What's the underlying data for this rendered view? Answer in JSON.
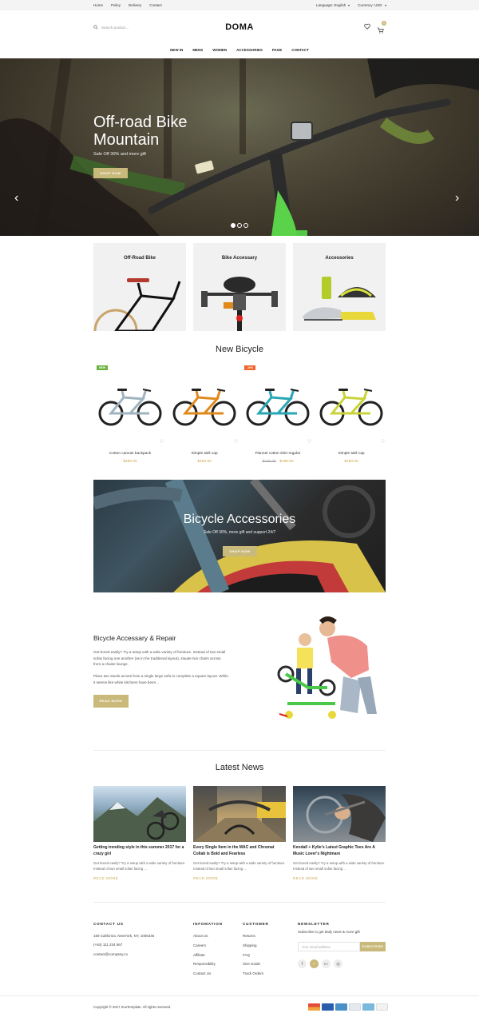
{
  "topbar": {
    "links": [
      "Home",
      "Policy",
      "Delivery",
      "Contact"
    ],
    "language": "Language: English",
    "currency": "Currency: USD"
  },
  "header": {
    "search_placeholder": "Search product...",
    "logo": "DOMA",
    "cart_count": "0"
  },
  "nav": [
    "NEW IN",
    "MENS",
    "WOMEN",
    "ACCESSORIES",
    "PAGE",
    "CONTACT"
  ],
  "hero": {
    "title_line1": "Off-road Bike",
    "title_line2": "Mountain",
    "subtitle": "Sale Off 30% and more gift",
    "cta": "SHOP NOW"
  },
  "categories": [
    "Off-Road Bike",
    "Bike Accessary",
    "Accessories"
  ],
  "new_bicycle": {
    "heading": "New Bicycle",
    "products": [
      {
        "name": "Cotton canvas backpack",
        "price": "$180.00",
        "old_price": "",
        "badge": "NEW",
        "frame_color": "#9fb4bf"
      },
      {
        "name": "Simple twill cap",
        "price": "$180.00",
        "old_price": "",
        "badge": "",
        "frame_color": "#e08a1e"
      },
      {
        "name": "Flannel cotton shirt regular",
        "price": "$199.00",
        "old_price": "$230.00",
        "badge": "-10%",
        "frame_color": "#2aa6b4"
      },
      {
        "name": "Simple twill cap",
        "price": "$180.00",
        "old_price": "",
        "badge": "",
        "frame_color": "#c8d43a"
      }
    ]
  },
  "accessories_banner": {
    "title": "Bicycle Accessories",
    "subtitle": "Sale Off 30%, more gift and support 24/7",
    "cta": "SHOP NOW"
  },
  "repair": {
    "title": "Bicycle Accessary & Repair",
    "para1": "Get bored easily? Try a setup with a wide variety of furniture. Instead of two small sofas facing one another (as in the traditional layout), situate two chairs across from a chaise lounge.",
    "para2": "Place two stools across from a single large sofa to complete a square layout. While it seems like white kitchens have been...",
    "cta": "READ MORE"
  },
  "news": {
    "heading": "Latest News",
    "items": [
      {
        "title": "Getting trending style in this summer 2017 for a crazy girl",
        "desc": "Get bored easily? Try a setup with a wide variety of furniture. Instead of two small sofas facing ...",
        "more": "READ MORE"
      },
      {
        "title": "Every Single Item in the MAC and Chromat Collab is Bold and Fearless",
        "desc": "Get bored easily? Try a setup with a wide variety of furniture. Instead of two small sofas facing ...",
        "more": "READ MORE"
      },
      {
        "title": "Kendall + Kylie's Latest Graphic Tees Are A Music Lover's Nightmare",
        "desc": "Get bored easily? Try a setup with a wide variety of furniture. Instead of two small sofas facing ...",
        "more": "READ MORE"
      }
    ]
  },
  "footer": {
    "contact": {
      "heading": "CONTACT US",
      "address": "169 California, NewYork, NY, 1006345",
      "phone": "(+84) 111 234 567",
      "email": "contact@company.co"
    },
    "information": {
      "heading": "INFOMATION",
      "links": [
        "About Us",
        "Careers",
        "Affiliate",
        "Responsibility",
        "Contact Us"
      ]
    },
    "customer": {
      "heading": "CUSTOMER",
      "links": [
        "Returns",
        "Shipping",
        "FAQ",
        "Size Guide",
        "Track Orders"
      ]
    },
    "newsletter": {
      "heading": "NEWSLETTER",
      "text": "Subscribe to get daily news & more gift",
      "placeholder": "Your email address",
      "button": "SUBSCRIBE",
      "social_icons": [
        "facebook-icon",
        "twitter-icon",
        "google-plus-icon",
        "instagram-icon"
      ]
    },
    "copyright": "Copyright © 2017  ZooTemplate. All rights reserved.",
    "payment_icons": [
      "mastercard-icon",
      "visa-icon",
      "amex-icon",
      "paypal-icon",
      "stripe-icon",
      "discover-icon"
    ]
  },
  "colors": {
    "accent": "#c9b97a",
    "price": "#c9a54a",
    "badge_new": "#6bb33d",
    "badge_sale": "#f0632a"
  }
}
